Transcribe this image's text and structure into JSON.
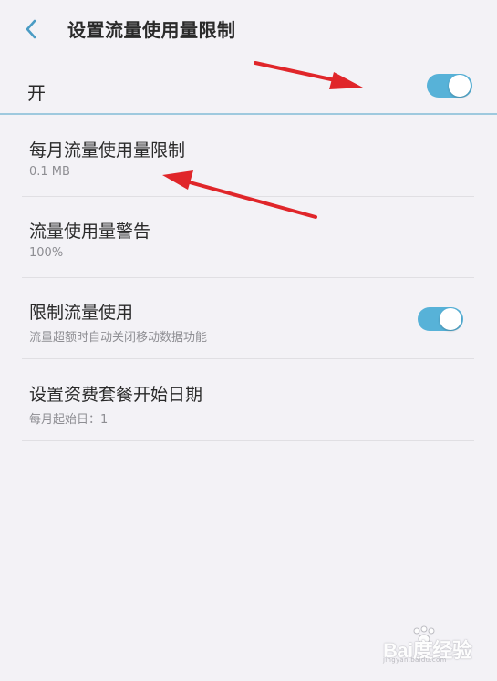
{
  "header": {
    "title": "设置流量使用量限制",
    "back_icon": "chevron-left-icon"
  },
  "master_switch": {
    "label": "开",
    "checked": true
  },
  "settings": [
    {
      "title": "每月流量使用量限制",
      "subtitle": "0.1 MB"
    },
    {
      "title": "流量使用量警告",
      "subtitle": "100%"
    },
    {
      "title": "限制流量使用",
      "subtitle": "流量超额时自动关闭移动数据功能",
      "toggle_checked": true
    },
    {
      "title": "设置资费套餐开始日期",
      "subtitle": "每月起始日：1"
    }
  ],
  "watermark": {
    "text": "Bai度经验",
    "sub": "jingyan.baidu.com"
  },
  "colors": {
    "background": "#f3f2f6",
    "accent": "#57b2d8",
    "annotation_arrow": "#e0262a"
  }
}
